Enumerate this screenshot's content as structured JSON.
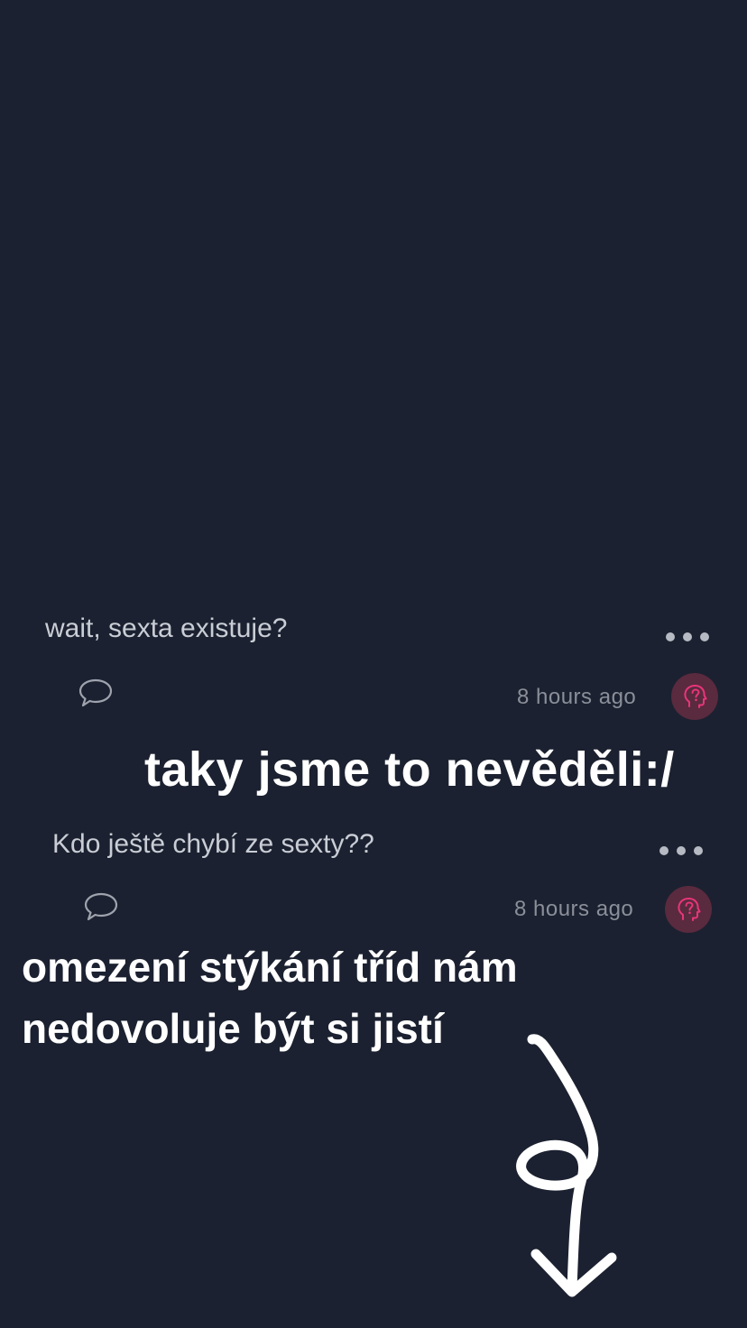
{
  "posts": [
    {
      "text": "wait, sexta existuje?",
      "time": "8 hours ago"
    },
    {
      "text": "Kdo ještě chybí ze sexty??",
      "time": "8 hours ago"
    }
  ],
  "captions": {
    "first": "taky jsme to nevěděli:/",
    "second": "omezení stýkání tříd nám nedovoluje být si jistí"
  },
  "icons": {
    "comment": "speech-bubble-icon",
    "more": "ellipsis-icon",
    "avatar": "anonymous-head-icon",
    "arrow": "hand-drawn-loop-arrow"
  },
  "colors": {
    "background": "#1b2130",
    "avatar_bg": "#5a2a3e",
    "avatar_icon": "#e8357a",
    "caption": "#ffffff"
  }
}
